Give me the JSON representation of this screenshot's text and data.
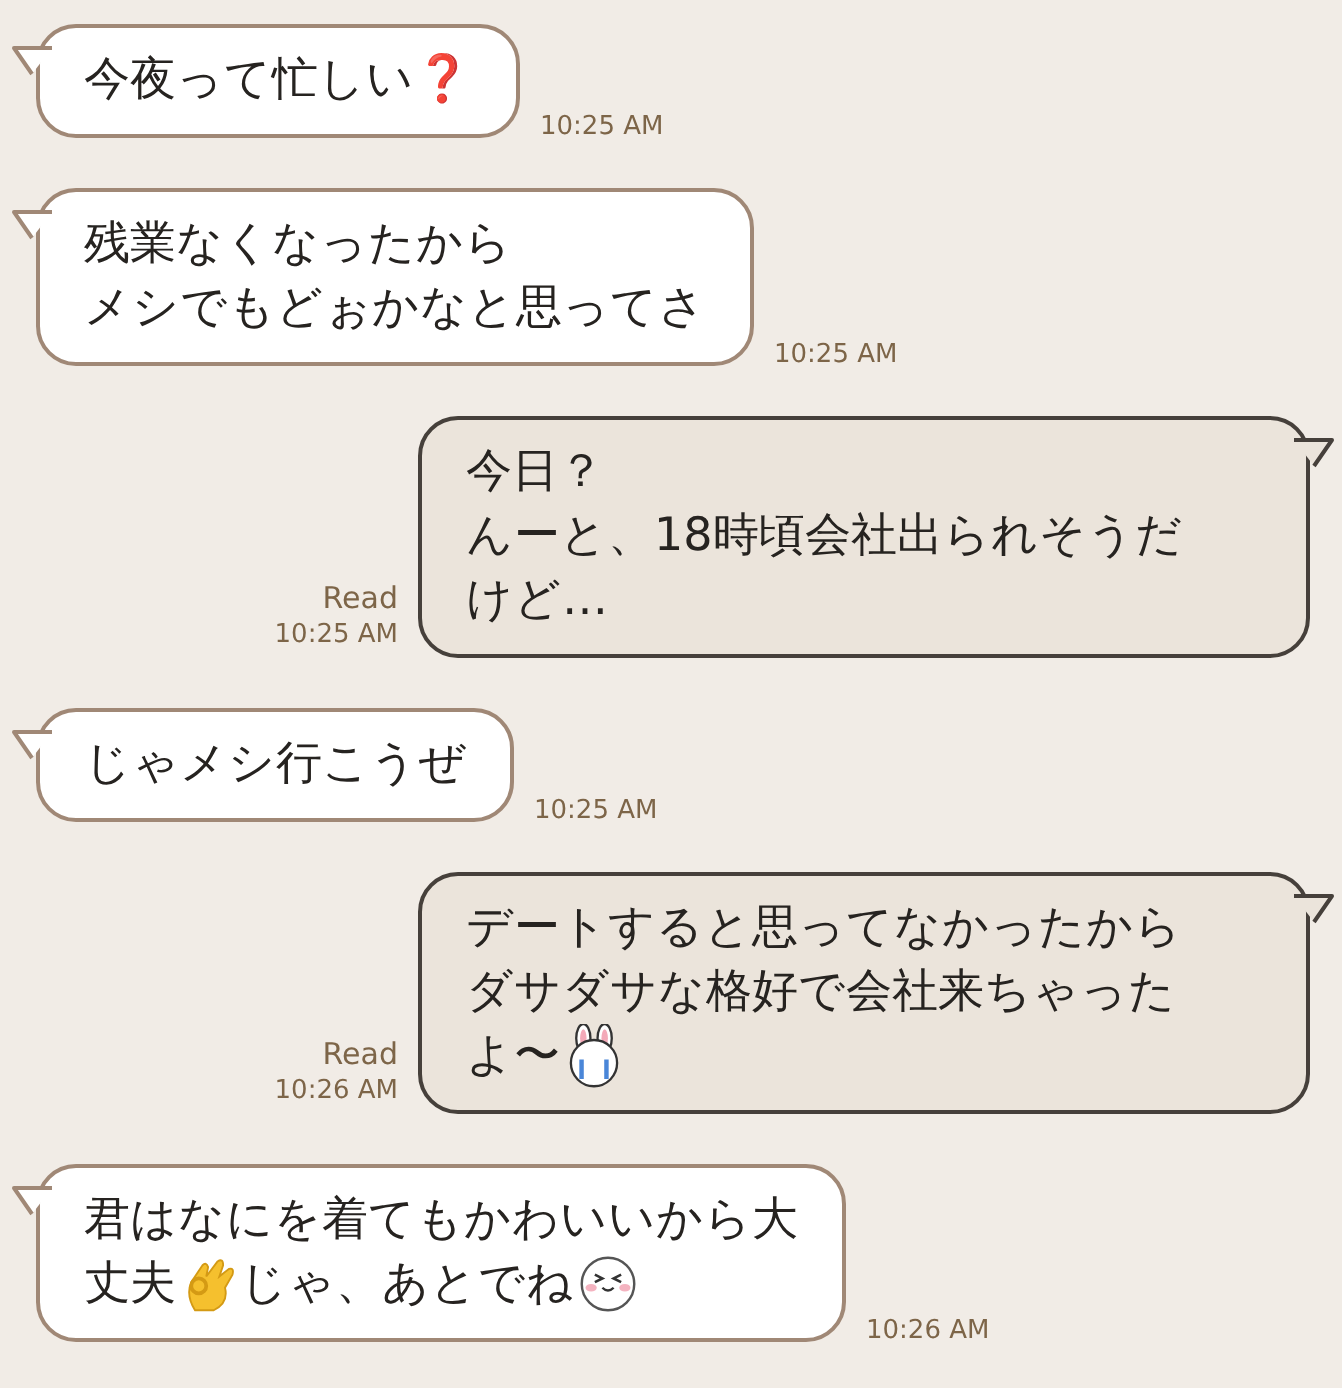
{
  "messages": [
    {
      "kind": "incoming",
      "lines": [
        [
          {
            "kind": "text",
            "text": "今夜って忙しい"
          },
          {
            "kind": "text",
            "text": "❓"
          }
        ]
      ],
      "time": "10:25 AM"
    },
    {
      "kind": "incoming",
      "lines": [
        [
          {
            "kind": "text",
            "text": "残業なくなったから"
          }
        ],
        [
          {
            "kind": "text",
            "text": "メシでもどぉかなと思ってさ"
          }
        ]
      ],
      "time": "10:25 AM"
    },
    {
      "kind": "outgoing",
      "lines": [
        [
          {
            "kind": "text",
            "text": "今日？"
          }
        ],
        [
          {
            "kind": "text",
            "text": "んーと、18時頃会社出られそうだ"
          }
        ],
        [
          {
            "kind": "text",
            "text": "けど…"
          }
        ]
      ],
      "read": "Read",
      "time": "10:25 AM"
    },
    {
      "kind": "incoming",
      "lines": [
        [
          {
            "kind": "text",
            "text": "じゃメシ行こうぜ"
          }
        ]
      ],
      "time": "10:25 AM"
    },
    {
      "kind": "outgoing",
      "lines": [
        [
          {
            "kind": "text",
            "text": "デートすると思ってなかったから"
          }
        ],
        [
          {
            "kind": "text",
            "text": "ダサダサな格好で会社来ちゃった"
          }
        ],
        [
          {
            "kind": "text",
            "text": "よ〜"
          },
          {
            "kind": "rabbit"
          }
        ]
      ],
      "read": "Read",
      "time": "10:26 AM"
    },
    {
      "kind": "incoming",
      "lines": [
        [
          {
            "kind": "text",
            "text": "君はなにを着てもかわいいから大"
          }
        ],
        [
          {
            "kind": "text",
            "text": "丈夫"
          },
          {
            "kind": "ok_hand"
          },
          {
            "kind": "text",
            "text": "じゃ、あとでね"
          },
          {
            "kind": "grin"
          }
        ]
      ],
      "time": "10:26 AM"
    }
  ]
}
